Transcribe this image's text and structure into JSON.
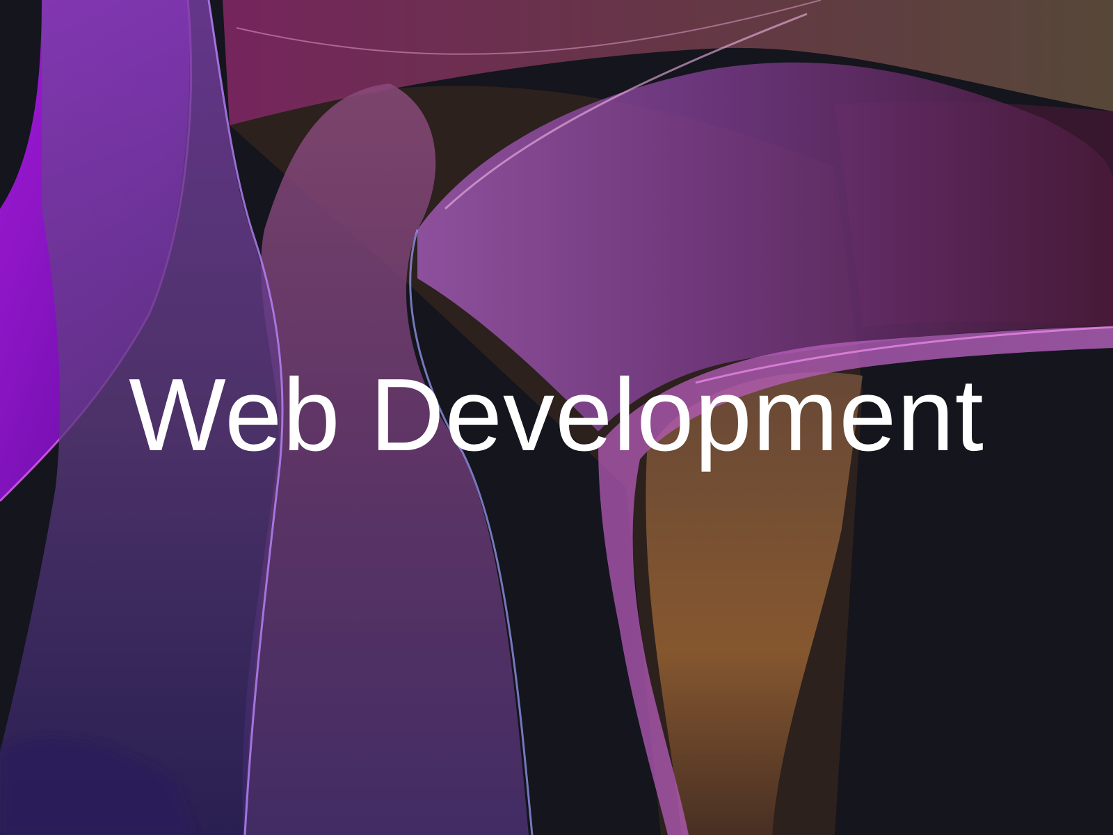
{
  "hero": {
    "title": "Web Development",
    "background_image": "abstract-translucent-ribbons-icon"
  },
  "palette": {
    "background": "#14151d",
    "ribbon_purple": "#8e16c8",
    "ribbon_magenta": "#d43ee6",
    "ribbon_violet": "#5a2c86",
    "ribbon_amber": "#b26a2a",
    "ribbon_plum": "#6a2a5a",
    "title_color": "#ffffff"
  }
}
